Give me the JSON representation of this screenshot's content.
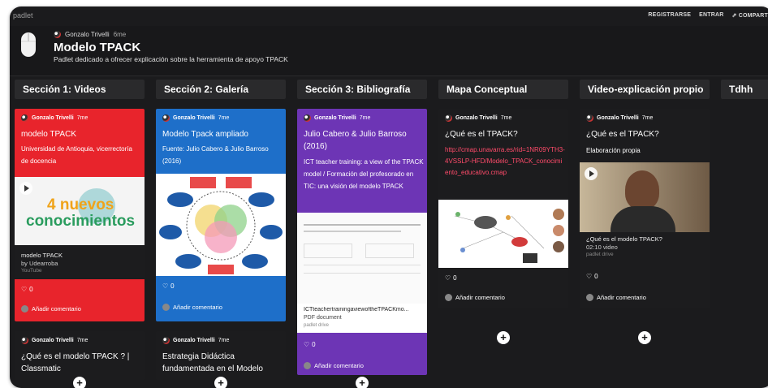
{
  "topbar": {
    "brand": "padlet",
    "nav": [
      "REGISTRARSE",
      "ENTRAR",
      "⇗ COMPART"
    ]
  },
  "header": {
    "author": "Gonzalo Trivelli",
    "time": "6me",
    "title": "Modelo TPACK",
    "description": "Padlet dedicado a ofrecer explicación sobre la herramienta de apoyo TPACK"
  },
  "columns": [
    {
      "title": "Sección 1: Videos"
    },
    {
      "title": "Sección 2: Galería"
    },
    {
      "title": "Sección 3: Bibliografía"
    },
    {
      "title": "Mapa Conceptual"
    },
    {
      "title": "Video-explicación propio"
    },
    {
      "title": "Tdhh"
    }
  ],
  "cards": {
    "c1": {
      "author": "Gonzalo Trivelli",
      "time": "7me",
      "title": "modelo TPACK",
      "body": "Universidad de Antioquia, vicerrectoría de docencia",
      "thumb_text_1": "4 nuevos",
      "thumb_text_2": "conocimientos",
      "att_title": "modelo TPACK",
      "att_by": "by Udearroba",
      "att_src": "YouTube",
      "likes": "0",
      "comment": "Añadir comentario"
    },
    "c2": {
      "author": "Gonzalo Trivelli",
      "time": "7me",
      "title": "Modelo Tpack ampliado",
      "body": "Fuente: Julio Cabero & Julio Barroso (2016)",
      "likes": "0",
      "comment": "Añadir comentario"
    },
    "c3": {
      "author": "Gonzalo Trivelli",
      "time": "7me",
      "title": "Julio Cabero & Julio Barroso (2016)",
      "body": "ICT teacher training: a view of the TPACK model / Formación del profesorado en TIC: una visión del modelo TPACK",
      "att_title": "ICTteachertrainingaviewoftheTPACKmo...",
      "att_type": "PDF document",
      "att_src": "padlet drive",
      "likes": "0",
      "comment": "Añadir comentario"
    },
    "c4": {
      "author": "Gonzalo Trivelli",
      "time": "7me",
      "title": "¿Qué es el TPACK?",
      "link": "http://cmap.unavarra.es/rid=1NR09YTH3-4VSSLP-HFD/Modelo_TPACK_conocimiento_educativo.cmap",
      "likes": "0",
      "comment": "Añadir comentario"
    },
    "c5": {
      "author": "Gonzalo Trivelli",
      "time": "7me",
      "title": "¿Qué es el TPACK?",
      "body": "Elaboración propia",
      "att_title": "¿Qué es el modelo TPACK?",
      "att_meta": "02:10 video",
      "att_src": "padlet drive",
      "likes": "0",
      "comment": "Añadir comentario"
    },
    "c6": {
      "author": "Gonzalo Trivelli",
      "time": "7me",
      "title": "¿Qué es el modelo TPACK ? | Classmatic"
    },
    "c7": {
      "author": "Gonzalo Trivelli",
      "time": "7me",
      "title": "Estrategia Didáctica fundamentada en el Modelo"
    }
  },
  "colors": {
    "red": "#e8242c",
    "blue": "#1e6fc9",
    "purple": "#6d35b5",
    "dark": "#1c1c1e",
    "link": "#ff4b6a"
  },
  "add_label": "+"
}
